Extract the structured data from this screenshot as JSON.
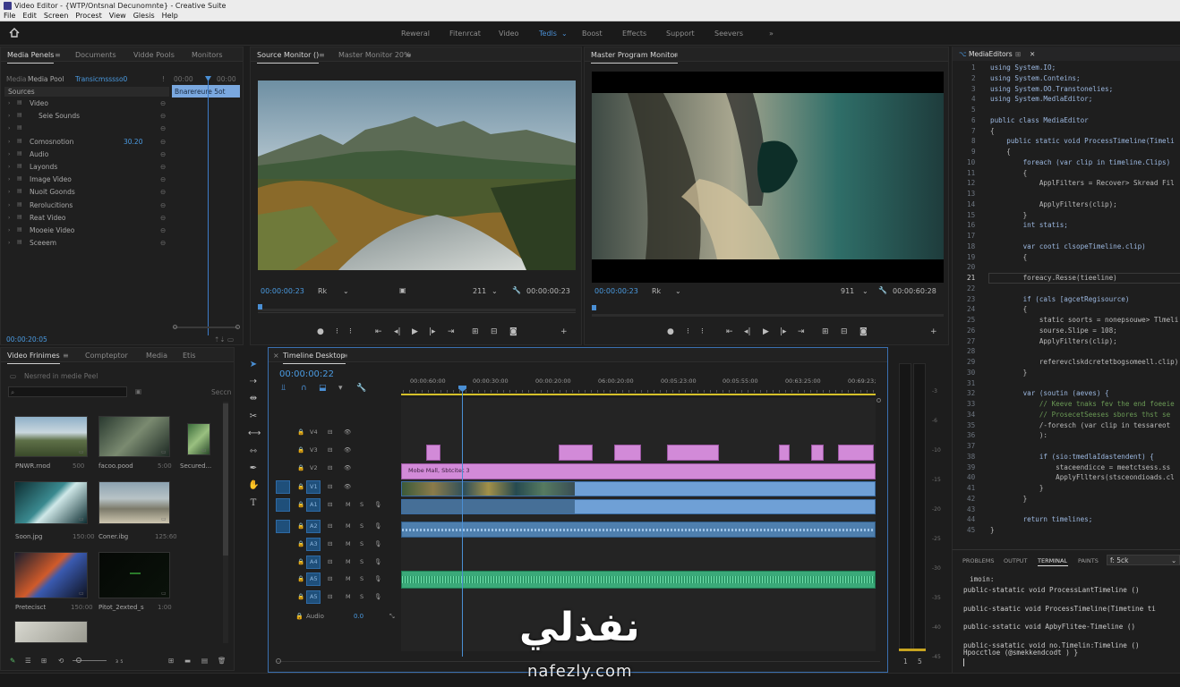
{
  "window": {
    "title": "Video Editor - {WTP/Ontsnal Decunomnte} - Creative Suite"
  },
  "menu": [
    "File",
    "Edit",
    "Screen",
    "Procest",
    "View",
    "Glesis",
    "Help"
  ],
  "workspaces": [
    "Reweral",
    "Fitenrcat",
    "Video",
    "Tedls",
    "Boost",
    "Effects",
    "Support",
    "Seevers"
  ],
  "active_workspace": "Tedls",
  "left_panel": {
    "tabs": [
      "Media Penels",
      "Documents",
      "Vidde Pools",
      "Monitors"
    ],
    "pool_label": "Media",
    "pool_name": "Media Pool",
    "pool_value": "Transicmsssso0",
    "sources_label": "Sources",
    "mini_time_a": "00:00",
    "mini_time_b": "00:00",
    "mini_clip": "Bnarereure 5ot",
    "items": [
      {
        "label": "Video",
        "value": ""
      },
      {
        "label": "Seie Sounds",
        "value": ""
      },
      {
        "label": "",
        "value": ""
      },
      {
        "label": "Comosnotion",
        "value": "30.20"
      },
      {
        "label": "Audio",
        "value": ""
      },
      {
        "label": "Layonds",
        "value": ""
      },
      {
        "label": "Image Video",
        "value": ""
      },
      {
        "label": "Nuoit Goonds",
        "value": ""
      },
      {
        "label": "Rerolucitions",
        "value": ""
      },
      {
        "label": "Reat Video",
        "value": ""
      },
      {
        "label": "Mooeie Video",
        "value": ""
      },
      {
        "label": "Sceeem",
        "value": ""
      }
    ],
    "footer_time": "00:00:20:05"
  },
  "source_monitor": {
    "tabs": [
      "Source Monitor ()",
      "Master Monitor 20%"
    ],
    "timecode": "00:00:00:23",
    "fit": "Rk",
    "zoom": "211",
    "duration": "00:00:00:23"
  },
  "program_monitor": {
    "tabs": [
      "Master Program Monitor"
    ],
    "timecode": "00:00:00:23",
    "fit": "Rk",
    "zoom": "911",
    "duration": "00:00:60:28"
  },
  "project_panel": {
    "tabs": [
      "Video Frinimes",
      "Compteptor",
      "Media",
      "Etis"
    ],
    "search_label": "Nesrred in medie Peel",
    "secc_label": "Seccn",
    "items": [
      {
        "name": "PNWR.rnod",
        "dur": "500"
      },
      {
        "name": "facoo.pood",
        "dur": "5:00"
      },
      {
        "name": "Secured...",
        "dur": ""
      },
      {
        "name": "Soon.jpg",
        "dur": "150:00"
      },
      {
        "name": "Coner.ibg",
        "dur": "125:60"
      },
      {
        "name": "Pretecisct",
        "dur": "150:00"
      },
      {
        "name": "Pitot_2exted_s",
        "dur": "1:00"
      }
    ]
  },
  "timeline": {
    "tab": "Timeline Desktop",
    "timecode": "00:00:00:22",
    "ruler": [
      "00:00:60:00",
      "00:00:30:00",
      "00:00:20:00",
      "06:00:20:00",
      "00:05:23:00",
      "00:05:55:00",
      "00:63:25:00",
      "00:69:23;"
    ],
    "tracks": [
      {
        "id": "V4",
        "label": "V4"
      },
      {
        "id": "V3",
        "label": "V3"
      },
      {
        "id": "V2",
        "label": "V2"
      },
      {
        "id": "V1",
        "label": "V1"
      },
      {
        "id": "A1",
        "label": "A1"
      },
      {
        "id": "A2",
        "label": "A2"
      },
      {
        "id": "A3",
        "label": "A3"
      },
      {
        "id": "A4",
        "label": "A4"
      },
      {
        "id": "A5",
        "label": "A5"
      }
    ],
    "audio_label": "Audio",
    "audio_value": "0.0",
    "title_clip": "Mobe Mall, Sbtcitet 3",
    "meter_scale": [
      "-3",
      "-6",
      "-10",
      "-15",
      "-20",
      "-25",
      "-30",
      "-35",
      "-40",
      "-45"
    ],
    "meter_footer": [
      "1",
      "5"
    ]
  },
  "code_editor": {
    "tab": "MediaEditors",
    "lines": [
      "using System.IO;",
      "using System.Conteins;",
      "using System.OO.Transtonelies;",
      "using System.MedlaEditor;",
      "",
      "public class MediaEditor",
      "{",
      "    public static void ProcessTimeline(Timeli",
      "    {",
      "        foreach (var clip in timeline.Clips)",
      "        {",
      "            ApplFilters = Recover> Skread Fil",
      "",
      "            ApplyFilters(clip);",
      "        }",
      "        int statis;",
      "",
      "        var cooti clsopeTimeline.clip)",
      "        {",
      "",
      "        foreacy.Resse(tieeline)",
      "",
      "        if (cals [agcetRegisource)",
      "        {",
      "            static soorts = nonepsouwe> Tlmeli",
      "            sourse.Slipe = 108;",
      "            ApplyFilters(clip);",
      "",
      "            referevclskdcretetbogsomeell.clip)",
      "        }",
      "",
      "        var (soutin (aeves) {",
      "            // Keeve tnaks fev the end foeeie",
      "            // ProsecetSeeses sbores thst se",
      "            /-foresch (var clip in tessareot",
      "            ):",
      "",
      "            if (sio:tmedlaIdastendent) {",
      "                staceendicce = meetctsess.ss",
      "                ApplyFllters(stsceondioads.cl",
      "            }",
      "        }",
      "",
      "        return timelines;",
      "}"
    ],
    "line_start": 1,
    "active_line": 21
  },
  "terminal": {
    "tabs": [
      "PROBLEMS",
      "OUTPUT",
      "TERMINAL",
      "PAINTS"
    ],
    "select": "f: 5ck",
    "lines": [
      "imoin:",
      "public-statatic void ProcessLantTimeline ()",
      "public-staatic void ProcessTimeline(Timetine ti",
      "public-sstatic void ApbyFlitee-Timeline ()",
      "public-ssatatic void no.Timelin:Timeline ()",
      "Hpocctloe (@smekkendcodt ) }"
    ]
  },
  "watermark": {
    "arabic": "نفذلي",
    "latin": "nafezly.com"
  }
}
